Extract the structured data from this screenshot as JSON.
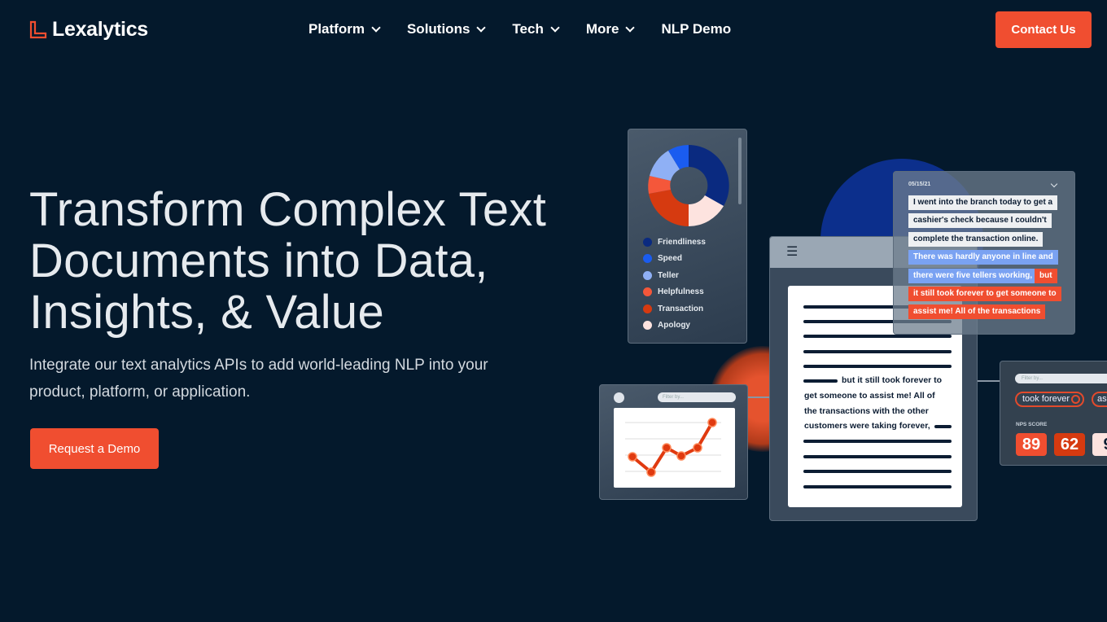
{
  "brand": {
    "name": "Lexalytics",
    "accent": "#f04e30"
  },
  "nav": {
    "items": [
      {
        "label": "Platform",
        "dropdown": true
      },
      {
        "label": "Solutions",
        "dropdown": true
      },
      {
        "label": "Tech",
        "dropdown": true
      },
      {
        "label": "More",
        "dropdown": true
      },
      {
        "label": "NLP Demo",
        "dropdown": false
      }
    ],
    "contact": "Contact Us"
  },
  "hero": {
    "title": "Transform Complex Text Documents into Data, Insights, & Value",
    "subtitle": "Integrate our text analytics APIs to add world-leading NLP into your product, platform, or application.",
    "cta": "Request a Demo"
  },
  "illustration": {
    "legend": [
      {
        "label": "Friendliness",
        "color": "#0a2a80"
      },
      {
        "label": "Speed",
        "color": "#1a5cf0"
      },
      {
        "label": "Teller",
        "color": "#8fb0f5"
      },
      {
        "label": "Helpfulness",
        "color": "#f4573a"
      },
      {
        "label": "Transaction",
        "color": "#d63a10"
      },
      {
        "label": "Apology",
        "color": "#fde3df"
      }
    ],
    "review": {
      "date": "05/15/21",
      "lines": [
        {
          "text": "I went into the branch today to get a",
          "tone": "neutral"
        },
        {
          "text": "cashier's check because I couldn't",
          "tone": "neutral"
        },
        {
          "text": "complete the transaction online.",
          "tone": "neutral"
        },
        {
          "text": "There was hardly anyone in line and",
          "tone": "positive"
        },
        {
          "text": "there were five tellers working,",
          "tone": "positive",
          "extra": "but"
        },
        {
          "text": "it still took forever to get someone to",
          "tone": "negative"
        },
        {
          "text": "assist me! All of the transactions",
          "tone": "negative"
        }
      ]
    },
    "doc_lines": [
      "but it still took forever to",
      "get someone to assist me! All of",
      "the transactions with the other",
      "customers were taking forever,"
    ],
    "filter_placeholder": "Filter by...",
    "tags": [
      "took forever",
      "as"
    ],
    "nps_label": "NPS SCORE",
    "nps_scores": [
      "89",
      "62",
      "9"
    ]
  }
}
